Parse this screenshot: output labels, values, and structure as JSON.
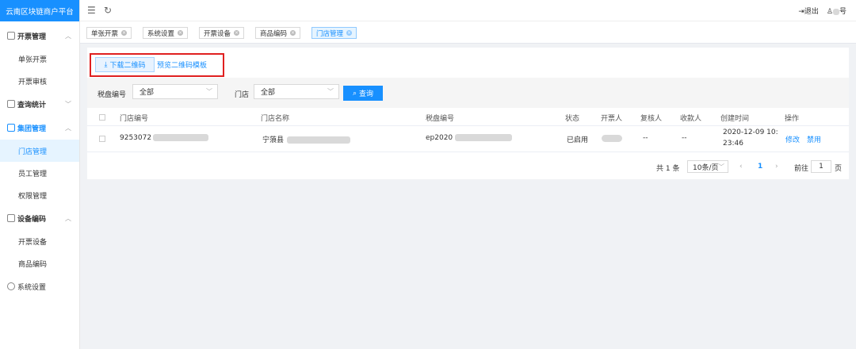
{
  "app": {
    "title": "云南区块链商户平台"
  },
  "header": {
    "logout_label": "退出",
    "user_name": "号"
  },
  "sidebar": {
    "groups": [
      {
        "label": "开票管理",
        "items": [
          "单张开票",
          "开票审核"
        ]
      },
      {
        "label": "查询统计",
        "items": []
      },
      {
        "label": "集团管理",
        "items": [
          "门店管理",
          "员工管理",
          "权限管理"
        ]
      },
      {
        "label": "设备编码",
        "items": [
          "开票设备",
          "商品编码"
        ]
      },
      {
        "label": "系统设置",
        "items": []
      }
    ]
  },
  "tabs": [
    "单张开票",
    "系统设置",
    "开票设备",
    "商品编码",
    "门店管理"
  ],
  "toolbar": {
    "download_label": "下载二维码",
    "preview_label": "预览二维码模板"
  },
  "filter": {
    "tax_disk_label": "税盘编号",
    "tax_disk_value": "全部",
    "store_label": "门店",
    "store_value": "全部",
    "query_label": "查询"
  },
  "table": {
    "headers": [
      "门店编号",
      "门店名称",
      "税盘编号",
      "状态",
      "开票人",
      "复核人",
      "收款人",
      "创建时间",
      "操作"
    ],
    "rows": [
      {
        "store_id": "9253072",
        "store_name": "宁蒗县",
        "tax_disk": "ep2020",
        "status": "已启用",
        "reviewer": "--",
        "payee": "--",
        "created_date": "2020-12-09 10:",
        "created_time": "23:46",
        "edit": "修改",
        "disable": "禁用"
      }
    ]
  },
  "pagination": {
    "total_text": "共 1 条",
    "page_size": "10条/页",
    "current_page": "1",
    "goto_label": "前往",
    "goto_value": "1",
    "page_unit": "页"
  },
  "colors": {
    "primary": "#1890ff",
    "highlight_box": "#e02020"
  }
}
